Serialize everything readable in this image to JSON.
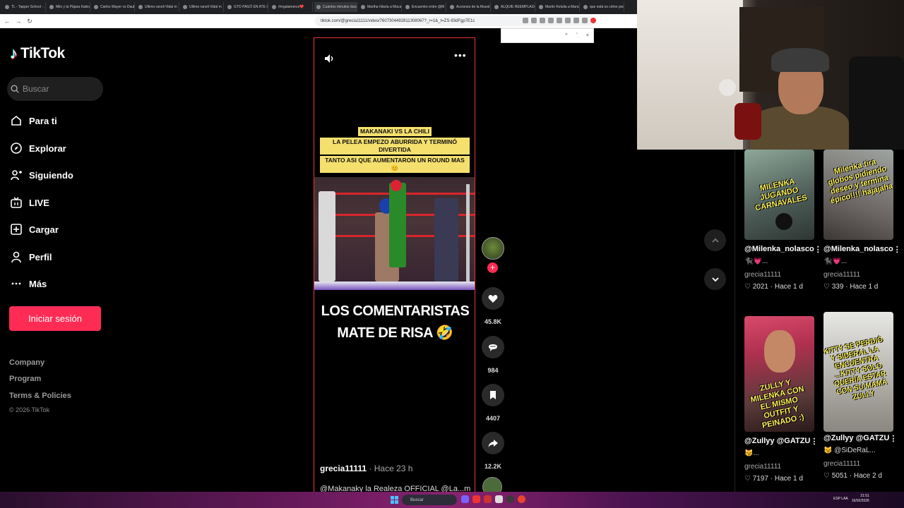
{
  "browser": {
    "tabs": [
      "TL - Tapper School - ...",
      "Milo y la Pájara Kakio",
      "Carlos Wayer vs Daub",
      "Ultimo ranoli Vidal m",
      "Ultimo ranoli Vidal m",
      "GTO PAGÓ EN ATE C",
      "#mgalamerce❤️",
      "Cuántos minutos dura",
      "Martha hilaría a Maca",
      "Encuentro entre @M",
      "Acciones de la Muest",
      "ALQUIE REEMPLAZA",
      "Martín Kelulia a Mano",
      "que está es cómo poder"
    ],
    "url": "tiktok.com/@grecia11111/video/7607304492811308067?_r=1&_t=ZS-93dFgp7E1c",
    "find_controls": [
      "^",
      "ˇ",
      "×"
    ]
  },
  "sidebar": {
    "logo": "TikTok",
    "search_placeholder": "Buscar",
    "nav": [
      {
        "label": "Para ti",
        "icon": "home-icon"
      },
      {
        "label": "Explorar",
        "icon": "compass-icon"
      },
      {
        "label": "Siguiendo",
        "icon": "following-icon"
      },
      {
        "label": "LIVE",
        "icon": "live-icon"
      },
      {
        "label": "Cargar",
        "icon": "upload-icon"
      },
      {
        "label": "Perfil",
        "icon": "profile-icon"
      },
      {
        "label": "Más",
        "icon": "more-icon"
      }
    ],
    "login": "Iniciar sesión",
    "footer": [
      "Company",
      "Program",
      "Terms & Policies"
    ],
    "copyright": "© 2026 TikTok"
  },
  "video": {
    "caption_lines": [
      "MAKANAKI VS LA CHILI",
      "LA PELEA EMPEZO ABURRIDA Y TERMINÓ DIVERTIDA",
      "TANTO ASI QUE AUMENTARON UN ROUND MAS 😊"
    ],
    "subtitle_lines": [
      "LOS COMENTARISTAS",
      "MATE DE RISA 🤣"
    ],
    "author": "grecia11111",
    "time": " · Hace 23 h",
    "description": "@Makanaky la Realeza OFFICIAL @La...",
    "more": "más"
  },
  "actions": {
    "likes": "45.8K",
    "comments": "984",
    "saves": "4407",
    "shares": "12.2K"
  },
  "related": [
    {
      "overlay": "MILENKA JUGANDO CARNAVALES",
      "title": "@Milenka_nolasco",
      "sub": "🐈‍⬛💗...",
      "user": "grecia11111",
      "stats": "♡ 2021 · Hace 1 d"
    },
    {
      "overlay": "Milenka tira globos pidiendo deseo y termina épico!!!! hajajaha",
      "title": "@Milenka_nolasco",
      "sub": "🐈‍⬛💗...",
      "user": "grecia11111",
      "stats": "♡ 339 · Hace 1 d"
    },
    {
      "overlay": "ZULLY Y MILENKA CON EL MISMO OUTFIT Y PEINADO :)",
      "title": "@Zullyy @GATZU",
      "sub": "😼...",
      "user": "grecia11111",
      "stats": "♡ 7197 · Hace 1 d"
    },
    {
      "overlay": "KITTY SE PERDIÓ Y SIDERAL LA ENCUENTRA ...KITTY SOLO QUERÍA ESTAR CON SU MAMÁ ZULLY",
      "title": "@Zullyy @GATZU",
      "sub": "😼 @SiDeRaL...",
      "user": "grecia11111",
      "stats": "♡ 5051 · Hace 2 d"
    }
  ],
  "taskbar": {
    "search": "Buscar",
    "lang": "ESP LAA",
    "time": "21:51",
    "date": "16/02/2026"
  },
  "colors": {
    "accent": "#fe2c55",
    "caption_bg": "#f5e06e",
    "overlay_text": "#fff35a"
  }
}
